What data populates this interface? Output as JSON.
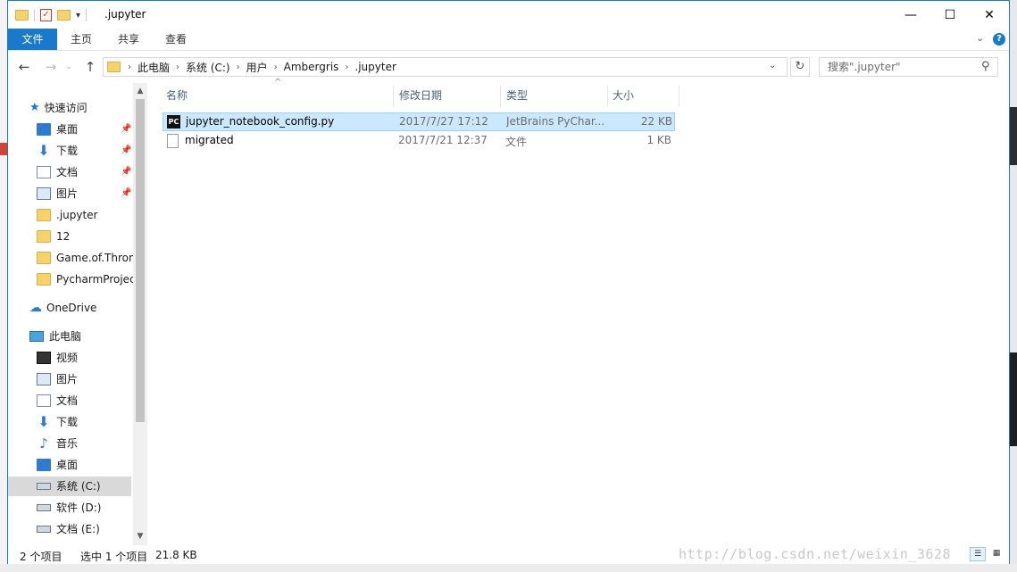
{
  "window": {
    "title": ".jupyter",
    "qat_dropdown": "▾",
    "minimize": "—",
    "maximize": "☐",
    "close": "✕"
  },
  "ribbon": {
    "tabs": [
      {
        "label": "文件",
        "active": true
      },
      {
        "label": "主页",
        "active": false
      },
      {
        "label": "共享",
        "active": false
      },
      {
        "label": "查看",
        "active": false
      }
    ],
    "expand": "⌄",
    "help": "?"
  },
  "navbar": {
    "back": "←",
    "forward": "→",
    "recent": "⌄",
    "up": "↑",
    "breadcrumb": [
      "此电脑",
      "系统 (C:)",
      "用户",
      "Ambergris",
      ".jupyter"
    ],
    "separator": "›",
    "dropdown": "⌄",
    "refresh": "↻",
    "search_placeholder": "搜索\".jupyter\"",
    "search_icon": "⚲"
  },
  "sidebar": {
    "quick_access": "快速访问",
    "quick_items": [
      {
        "label": "桌面",
        "icon": "desktop-icon",
        "pinned": true
      },
      {
        "label": "下载",
        "icon": "download-icon",
        "pinned": true
      },
      {
        "label": "文档",
        "icon": "document-icon",
        "pinned": true
      },
      {
        "label": "图片",
        "icon": "picture-icon",
        "pinned": true
      },
      {
        "label": ".jupyter",
        "icon": "folder-icon",
        "pinned": false
      },
      {
        "label": "12",
        "icon": "folder-icon",
        "pinned": false
      },
      {
        "label": "Game.of.Throne",
        "icon": "folder-icon",
        "pinned": false
      },
      {
        "label": "PycharmProject",
        "icon": "folder-icon",
        "pinned": false
      }
    ],
    "onedrive": "OneDrive",
    "this_pc": "此电脑",
    "pc_items": [
      {
        "label": "视频",
        "icon": "video-icon"
      },
      {
        "label": "图片",
        "icon": "picture-icon"
      },
      {
        "label": "文档",
        "icon": "document-icon"
      },
      {
        "label": "下载",
        "icon": "download-icon"
      },
      {
        "label": "音乐",
        "icon": "music-icon"
      },
      {
        "label": "桌面",
        "icon": "desktop-icon"
      },
      {
        "label": "系统 (C:)",
        "icon": "drive-icon",
        "selected": true
      },
      {
        "label": "软件 (D:)",
        "icon": "drive-icon"
      },
      {
        "label": "文档 (E:)",
        "icon": "drive-icon"
      }
    ],
    "pin_glyph": "📌",
    "scroll_up": "▲",
    "scroll_down": "▼"
  },
  "file_list": {
    "columns": [
      "名称",
      "修改日期",
      "类型",
      "大小"
    ],
    "sort_indicator": "^",
    "rows": [
      {
        "name": "jupyter_notebook_config.py",
        "date": "2017/7/27 17:12",
        "type": "JetBrains PyChar...",
        "size": "22 KB",
        "selected": true,
        "icon": "pycharm-file-icon",
        "icon_text": "PC"
      },
      {
        "name": "migrated",
        "date": "2017/7/21 12:37",
        "type": "文件",
        "size": "1 KB",
        "selected": false,
        "icon": "file-icon",
        "icon_text": ""
      }
    ]
  },
  "status": {
    "count": "2 个项目",
    "selected": "选中 1 个项目",
    "size": "21.8 KB",
    "details_view": "☰",
    "icons_view": "▦"
  },
  "watermark": "http://blog.csdn.net/weixin_3628"
}
